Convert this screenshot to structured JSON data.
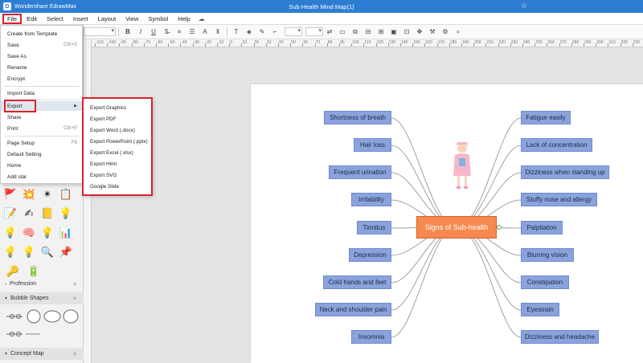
{
  "titlebar": {
    "app_name": "Wondershare EdrawMax",
    "doc_title": "Sub Health Mind Map(1)"
  },
  "menubar": {
    "items": [
      "File",
      "Edit",
      "Select",
      "Insert",
      "Layout",
      "View",
      "Symbol",
      "Help"
    ],
    "active": "File"
  },
  "file_menu": {
    "items": [
      {
        "label": "Create from Template",
        "shortcut": ""
      },
      {
        "label": "Save",
        "shortcut": "Ctrl+S"
      },
      {
        "label": "Save As",
        "shortcut": ""
      },
      {
        "label": "Rename",
        "shortcut": ""
      },
      {
        "label": "Encrypt",
        "shortcut": ""
      },
      {
        "label": "Import Data",
        "shortcut": ""
      },
      {
        "label": "Export",
        "shortcut": ""
      },
      {
        "label": "Share",
        "shortcut": ""
      },
      {
        "label": "Print",
        "shortcut": "Ctrl+P"
      },
      {
        "label": "Page Setup",
        "shortcut": "F6"
      },
      {
        "label": "Default Setting",
        "shortcut": ""
      },
      {
        "label": "Home",
        "shortcut": ""
      },
      {
        "label": "Add star",
        "shortcut": ""
      }
    ]
  },
  "export_menu": {
    "items": [
      "Export Graphics",
      "Export PDF",
      "Export Word (.docx)",
      "Export PowerPoint (.pptx)",
      "Export Excel (.xlsx)",
      "Export Html",
      "Export SVG",
      "Google Slide"
    ]
  },
  "library": {
    "sections": [
      "Profession",
      "Bubble Shapes",
      "Concept Map"
    ]
  },
  "ruler": {
    "ticks": [
      "-110",
      "-100",
      "-90",
      "-80",
      "-70",
      "-60",
      "-50",
      "-40",
      "-30",
      "-20",
      "-10",
      "0",
      "10",
      "20",
      "30",
      "40",
      "50",
      "60",
      "70",
      "80",
      "90",
      "100",
      "110",
      "120",
      "130",
      "140",
      "150",
      "160",
      "170",
      "180",
      "190",
      "200",
      "210",
      "220",
      "230",
      "240",
      "250",
      "260",
      "270",
      "280",
      "290",
      "300",
      "310",
      "320",
      "330"
    ]
  },
  "mindmap": {
    "center": "Signs of Sub-health",
    "left_nodes": [
      "Shortness of breath",
      "Hair loss",
      "Frequent urination",
      "Irritability",
      "Tinnitus",
      "Depression",
      "Cold hands and feet",
      "Neck and shoulder pain",
      "Insomnia"
    ],
    "right_nodes": [
      "Fatigue easily",
      "Lack of concentration",
      "Dizziness when standing up",
      "Stuffy nose and allergy",
      "Palpitation",
      "Blurring vision",
      "Constipation",
      "Eyestrain",
      "Dizziness and headache"
    ]
  },
  "colors": {
    "titlebar": "#2d7dd2",
    "highlight": "#d9232d",
    "node_fill": "#8aa3dc",
    "center_fill": "#f5894f"
  }
}
